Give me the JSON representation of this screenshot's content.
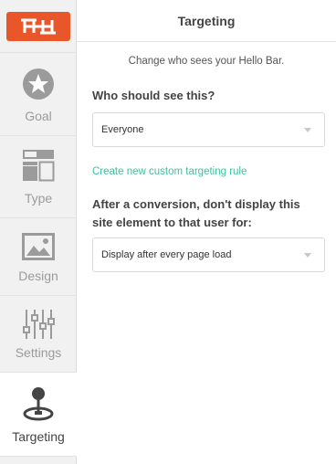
{
  "sidebar": {
    "logo": {
      "icon": "hellobar-logo-icon",
      "color": "#e8562a"
    },
    "items": [
      {
        "label": "Goal",
        "icon": "star-icon"
      },
      {
        "label": "Type",
        "icon": "layout-grid-icon"
      },
      {
        "label": "Design",
        "icon": "image-icon"
      },
      {
        "label": "Settings",
        "icon": "sliders-icon"
      },
      {
        "label": "Targeting",
        "icon": "joystick-icon",
        "active": true
      }
    ]
  },
  "main": {
    "title": "Targeting",
    "subtitle": "Change who sees your Hello Bar.",
    "who_title": "Who should see this?",
    "who_select_value": "Everyone",
    "custom_rule_link": "Create new custom targeting rule",
    "after_title": "After a conversion, don't display this site element to that user for:",
    "after_select_value": "Display after every page load"
  },
  "colors": {
    "accent": "#e8562a",
    "link": "#3fbf9f"
  }
}
